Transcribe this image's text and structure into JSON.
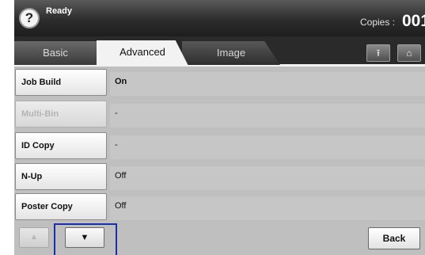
{
  "status": {
    "help_icon": "?",
    "text": "Ready",
    "copies_label": "Copies :",
    "copies_value": "001"
  },
  "tabs": {
    "basic": "Basic",
    "advanced": "Advanced",
    "image": "Image",
    "save_icon": "save-to-box-icon",
    "home_icon": "home-icon"
  },
  "rows": [
    {
      "label": "Job Build",
      "value": "On",
      "enabled": true
    },
    {
      "label": "Multi-Bin",
      "value": "-",
      "enabled": false
    },
    {
      "label": "ID Copy",
      "value": "-",
      "enabled": true
    },
    {
      "label": "N-Up",
      "value": "Off",
      "enabled": true
    },
    {
      "label": "Poster Copy",
      "value": "Off",
      "enabled": true
    }
  ],
  "nav": {
    "up_glyph": "▲",
    "down_glyph": "▼",
    "back_label": "Back"
  }
}
